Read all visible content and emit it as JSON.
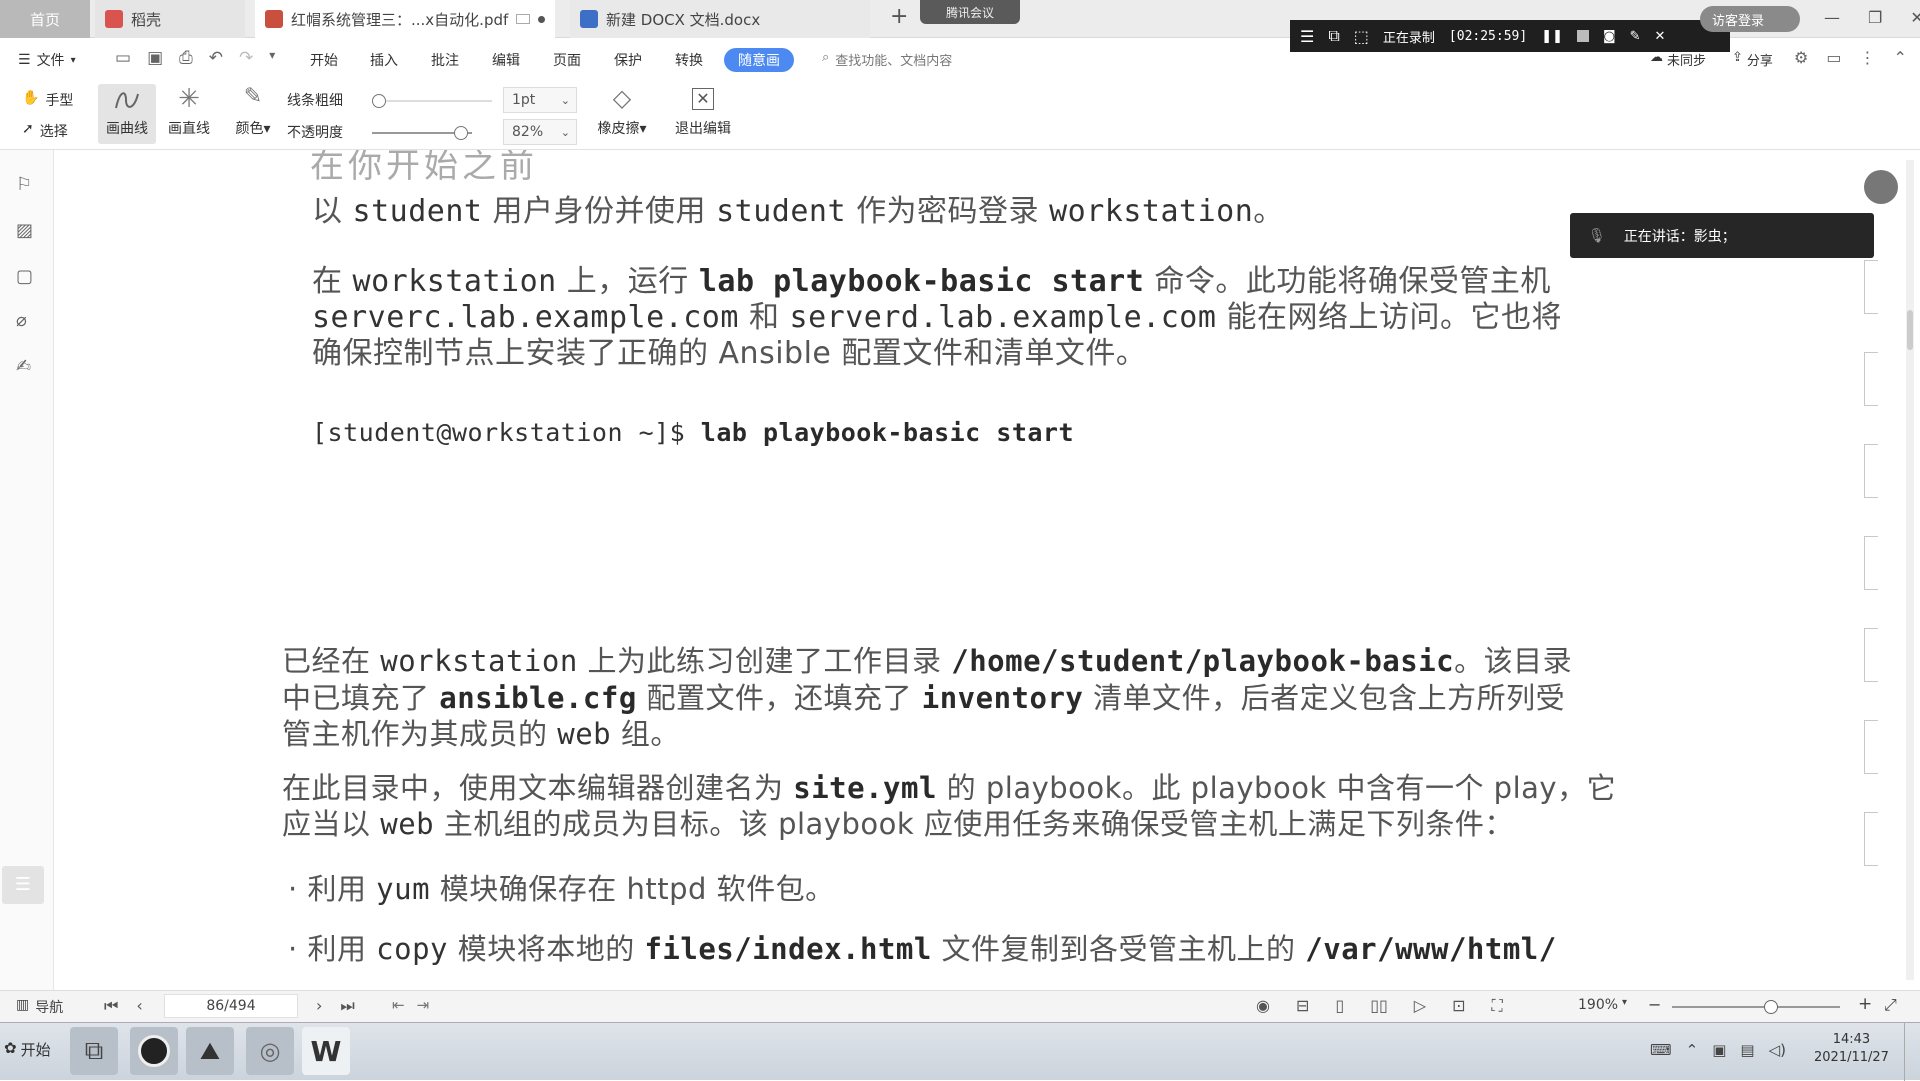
{
  "tabs": {
    "home": "首页",
    "daoke": "稻壳",
    "pdf": "红帽系统管理三：...x自动化.pdf",
    "docx": "新建 DOCX 文档.docx",
    "add": "+",
    "meeting": "腾讯会议"
  },
  "recorder": {
    "status": "正在录制",
    "time": "[02:25:59]",
    "login": "访客登录"
  },
  "menu": {
    "file": "文件",
    "items": [
      "开始",
      "插入",
      "批注",
      "编辑",
      "页面",
      "保护",
      "转换"
    ],
    "active": "随意画",
    "search_placeholder": "查找功能、文档内容",
    "sync": "未同步",
    "share": "分享"
  },
  "toolbar": {
    "hand": "手型",
    "select": "选择",
    "draw_curve": "画曲线",
    "draw_line": "画直线",
    "color": "颜色",
    "line_width_label": "线条粗细",
    "opacity_label": "不透明度",
    "line_width_value": "1pt",
    "opacity_value": "82%",
    "eraser": "橡皮擦",
    "exit_edit": "退出编辑"
  },
  "document": {
    "cut_heading": "在你开始之前",
    "p1": {
      "a": "以",
      "b": "student",
      "c": "用户身份并使用",
      "d": "student",
      "e": "作为密码登录",
      "f": "workstation",
      "g": "。"
    },
    "p2": {
      "l1a": "在",
      "l1b": "workstation",
      "l1c": "上，运行",
      "l1d": "lab playbook-basic start",
      "l1e": "命令。此功能将确保受管主机",
      "l2a": "serverc.lab.example.com",
      "l2b": "和",
      "l2c": "serverd.lab.example.com",
      "l2d": "能在网络上访问。它也将",
      "l3": "确保控制节点上安装了正确的 Ansible 配置文件和清单文件。"
    },
    "command": {
      "prompt": "[student@workstation ~]$ ",
      "cmd": "lab playbook-basic start"
    },
    "p3": {
      "l1a": "已经在",
      "l1b": "workstation",
      "l1c": "上为此练习创建了工作目录",
      "l1d": "/home/student/playbook-basic",
      "l1e": "。该目录",
      "l2a": "中已填充了",
      "l2b": "ansible.cfg",
      "l2c": "配置文件，还填充了",
      "l2d": "inventory",
      "l2e": "清单文件，后者定义包含上方所列受",
      "l3a": "管主机作为其成员的",
      "l3b": "web",
      "l3c": "组。"
    },
    "p4": {
      "l1a": "在此目录中，使用文本编辑器创建名为",
      "l1b": "site.yml",
      "l1c": "的 playbook。此 playbook 中含有一个 play，它",
      "l2a": "应当以",
      "l2b": "web",
      "l2c": "主机组的成员为目标。该 playbook 应使用任务来确保受管主机上满足下列条件："
    },
    "bullet1": {
      "a": "利用",
      "b": "yum",
      "c": "模块确保存在 httpd 软件包。"
    },
    "bullet2": {
      "a": "利用",
      "b": "copy",
      "c": "模块将本地的",
      "d": "files/index.html",
      "e": "文件复制到各受管主机上的",
      "f": "/var/www/html/"
    }
  },
  "speaking": "正在讲话：影虫；",
  "status": {
    "nav": "导航",
    "page": "86/494",
    "zoom": "190%"
  },
  "taskbar": {
    "start": "开始",
    "time": "14:43",
    "date": "2021/11/27"
  },
  "colors": {
    "accent": "#4c8af2",
    "recorder_bg": "#1f1f1f",
    "taskbar": "#cbd3dc"
  }
}
